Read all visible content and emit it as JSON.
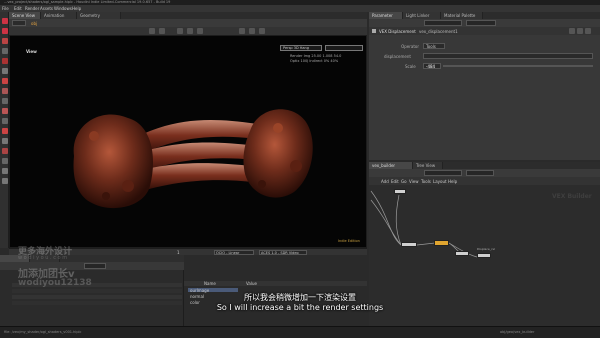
{
  "title_bar": {
    "text": "...vex_project/shaders/ogl_sample.hiplc - Houdini Indie Limited-Commercial 19.0.657 - Build 19"
  },
  "menu": [
    "File",
    "Edit",
    "Render",
    "Assets",
    "Windows",
    "Help"
  ],
  "viewer": {
    "tabs": [
      "Scene View",
      "Animation Editor",
      "Geometry Spreadsheet"
    ],
    "path": "obj",
    "label": "View",
    "camera_menu": "Persp 3D Hang",
    "hud_lines": [
      "Render Img  25.00    1.008  54.0",
      "   Optix  100J  Indirect 0% 40%"
    ],
    "watermark_label": "Indie Edition"
  },
  "timeline": {
    "frame": "1",
    "fields": [
      "OCIO - Linear",
      "ACES 1.0 - SDR Video"
    ]
  },
  "params": {
    "tabs": [
      "Parameter",
      "Light Linker",
      "Material Palette"
    ],
    "node_header": "VEX Displacement",
    "path_field": "vex_displacement1",
    "rows": [
      {
        "label": "Operator",
        "value": "Tools"
      },
      {
        "label": "displacement",
        "value": ""
      },
      {
        "label": "Scale",
        "value": "-484"
      }
    ]
  },
  "network": {
    "tabs": [
      "vex_builder",
      "Tree View"
    ],
    "menu": [
      "Add",
      "Edit",
      "Go",
      "View",
      "Tools",
      "Layout",
      "Help"
    ],
    "watermark": "VEX Builder",
    "node_labels": [
      "Displace_rsl"
    ]
  },
  "spreadsheet": {
    "columns": [
      "Name",
      "Value"
    ],
    "rows": [
      "ourImage",
      "normal",
      "color"
    ]
  },
  "subtitle": {
    "zh": "所以我会稍微增加一下渲染设置",
    "en": "So I will increase a bit the render settings"
  },
  "overlay_watermark": {
    "line1": "更多海外设计",
    "line2": "w o d i y o u . c o m",
    "line3": "加添加团长v",
    "line4": "wodiyou12138"
  },
  "status_bar": {
    "left": "file: /vex/my_shader/ogl_shaders_v001.hiplc",
    "right": "obj/geo/vex_builder"
  }
}
